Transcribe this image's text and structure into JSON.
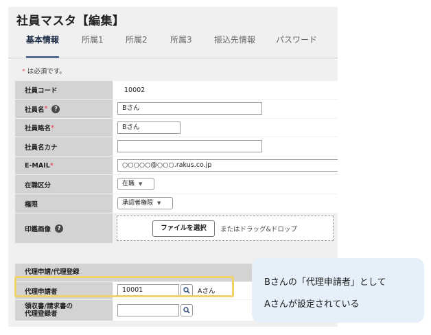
{
  "page": {
    "title": "社員マスタ【編集】"
  },
  "tabs": [
    {
      "label": "基本情報",
      "active": true
    },
    {
      "label": "所属1"
    },
    {
      "label": "所属2"
    },
    {
      "label": "所属3"
    },
    {
      "label": "振込先情報"
    },
    {
      "label": "パスワード"
    }
  ],
  "required_note": {
    "star": "*",
    "text": " は必須です。"
  },
  "form": {
    "employee_code": {
      "label": "社員コード",
      "value": "10002"
    },
    "employee_name": {
      "label": "社員名",
      "star": "*",
      "help": "?",
      "value": "Bさん"
    },
    "employee_short_name": {
      "label": "社員略名",
      "star": "*",
      "value": "Bさん"
    },
    "employee_kana": {
      "label": "社員名カナ",
      "value": ""
    },
    "email": {
      "label": "E-MAIL",
      "star": "*",
      "value": "○○○○○@○○○.rakus.co.jp"
    },
    "employment_status": {
      "label": "在職区分",
      "value": "在職",
      "caret": "▼"
    },
    "authority": {
      "label": "権限",
      "value": "承認者権限",
      "caret": "▼"
    },
    "seal_image": {
      "label": "印鑑画像",
      "help": "?",
      "button": "ファイルを選択",
      "drop_text": "またはドラッグ&ドロップ"
    }
  },
  "proxy_section": {
    "title": "代理申請/代理登録",
    "proxy_applicant": {
      "label": "代理申請者",
      "value": "10001",
      "name": "Aさん"
    },
    "receipt_proxy": {
      "label_line1": "領収書/請求書の",
      "label_line2": "代理登録者",
      "value": ""
    }
  },
  "callout": {
    "line1": "Bさんの「代理申請者」として",
    "line2": "Aさんが設定されている",
    "background": "#e6f0fa",
    "highlight_color": "#f0d26b"
  },
  "icons": [
    "search-icon",
    "help-icon",
    "chevron-down-icon"
  ]
}
